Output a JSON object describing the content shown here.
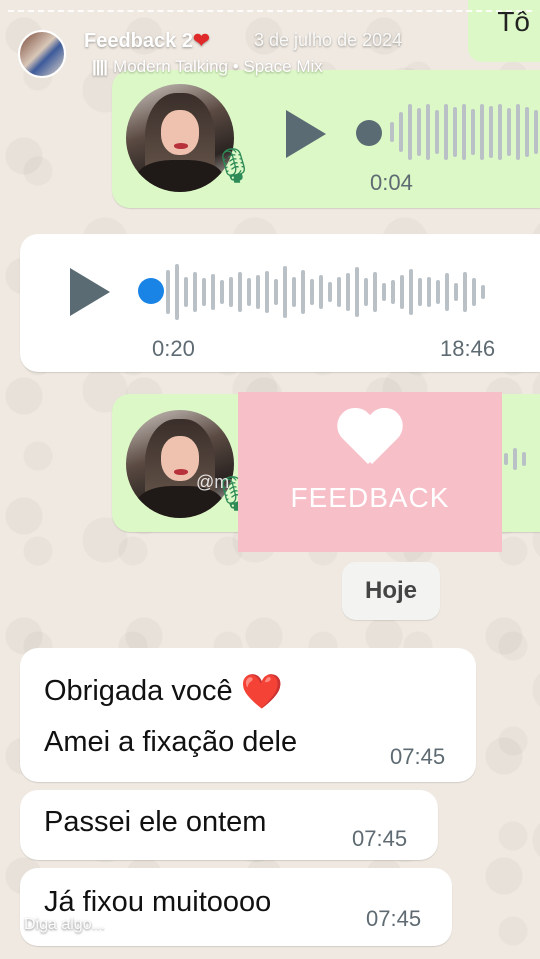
{
  "story": {
    "title": "Feedback 2",
    "title_emoji": "❤",
    "date": "3 de julho de 2024",
    "music_icon": "||||",
    "music": "Modern Talking • Space Mix",
    "reply_placeholder": "Diga algo..."
  },
  "chat": {
    "top_stub_text": "Tô",
    "voice_messages": [
      {
        "direction": "outgoing",
        "duration": "0:04",
        "has_avatar": true,
        "icon": "mic-icon"
      },
      {
        "direction": "incoming",
        "duration": "0:20",
        "time": "18:46"
      },
      {
        "direction": "outgoing",
        "has_avatar": true,
        "icon": "mic-icon"
      }
    ],
    "sticker": {
      "icon": "heart-icon",
      "label": "FEEDBACK",
      "watermark": "@m"
    },
    "date_chip": "Hoje",
    "messages": [
      {
        "line1": "Obrigada você",
        "emoji": "❤️",
        "line2": "Amei a fixação dele",
        "time": "07:45"
      },
      {
        "text": "Passei ele ontem",
        "time": "07:45"
      },
      {
        "text": "Já fixou muitoooo",
        "time": "07:45"
      }
    ]
  },
  "colors": {
    "outgoing_bubble": "#dcf8c6",
    "incoming_bubble": "#ffffff",
    "sticker_bg": "#f7bfc8",
    "play_active_dot": "#1a84e6"
  }
}
